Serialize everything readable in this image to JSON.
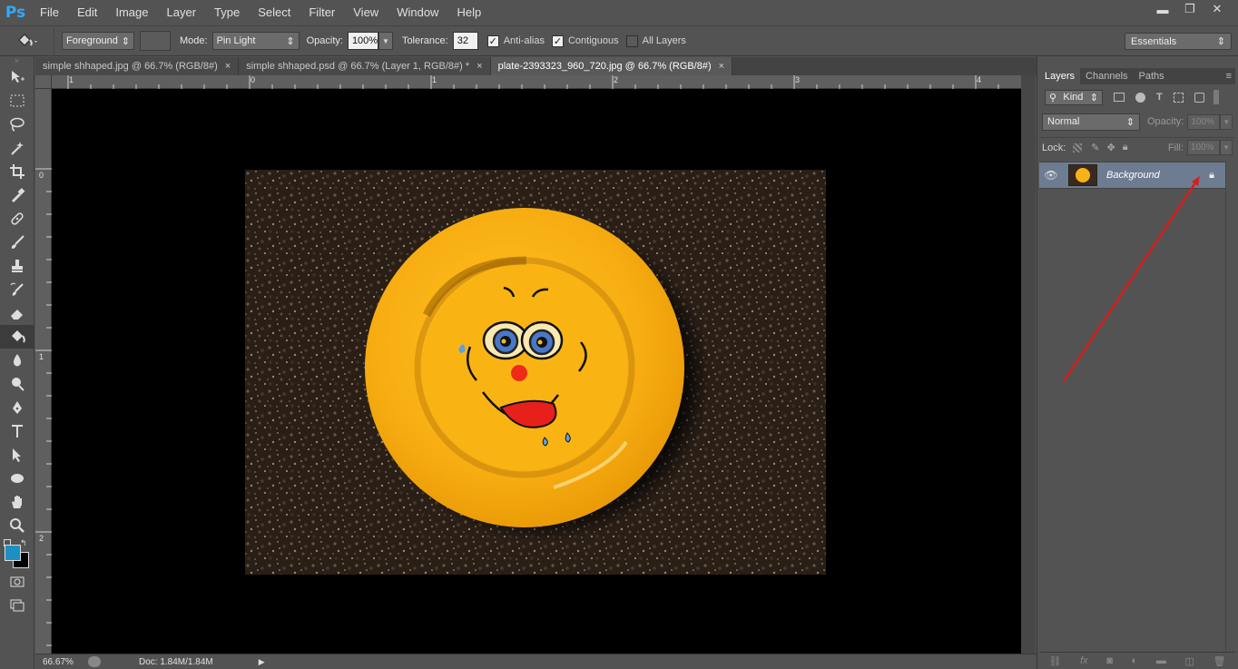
{
  "app": {
    "logo": "Ps"
  },
  "menu": [
    "File",
    "Edit",
    "Image",
    "Layer",
    "Type",
    "Select",
    "Filter",
    "View",
    "Window",
    "Help"
  ],
  "window_controls": {
    "minimize": "▬",
    "restore": "❐",
    "close": "✕"
  },
  "options": {
    "fill_source": "Foreground",
    "mode_label": "Mode:",
    "mode_value": "Pin Light",
    "opacity_label": "Opacity:",
    "opacity_value": "100%",
    "tolerance_label": "Tolerance:",
    "tolerance_value": "32",
    "anti_alias_label": "Anti-alias",
    "anti_alias_checked": true,
    "contiguous_label": "Contiguous",
    "contiguous_checked": true,
    "all_layers_label": "All Layers",
    "all_layers_checked": false
  },
  "workspace": "Essentials",
  "tabs": [
    {
      "title": "simple shhaped.jpg @ 66.7% (RGB/8#)",
      "close": "×",
      "active": false
    },
    {
      "title": "simple shhaped.psd @ 66.7% (Layer 1, RGB/8#) *",
      "close": "×",
      "active": false
    },
    {
      "title": "plate-2393323_960_720.jpg @ 66.7% (RGB/8#)",
      "close": "×",
      "active": true
    }
  ],
  "ruler": {
    "top": [
      "1",
      "0",
      "1",
      "2",
      "3",
      "4"
    ],
    "left": [
      "0",
      "1",
      "2"
    ]
  },
  "status": {
    "zoom": "66.67%",
    "doc": "Doc: 1.84M/1.84M",
    "arrow": "▶"
  },
  "panels": {
    "tabs": [
      "Layers",
      "Channels",
      "Paths"
    ],
    "kind_label": "Kind",
    "blend_mode": "Normal",
    "opacity_label": "Opacity:",
    "opacity_value": "100%",
    "lock_label": "Lock:",
    "fill_label": "Fill:",
    "fill_value": "100%",
    "layers": [
      {
        "name": "Background",
        "locked": true,
        "visible": true
      }
    ]
  },
  "colors": {
    "foreground": "#1e8fc2",
    "background": "#000000",
    "annotation_arrow": "#d41f1f",
    "plate": "#f7b21a",
    "selected_layer": "#6e7c91"
  }
}
